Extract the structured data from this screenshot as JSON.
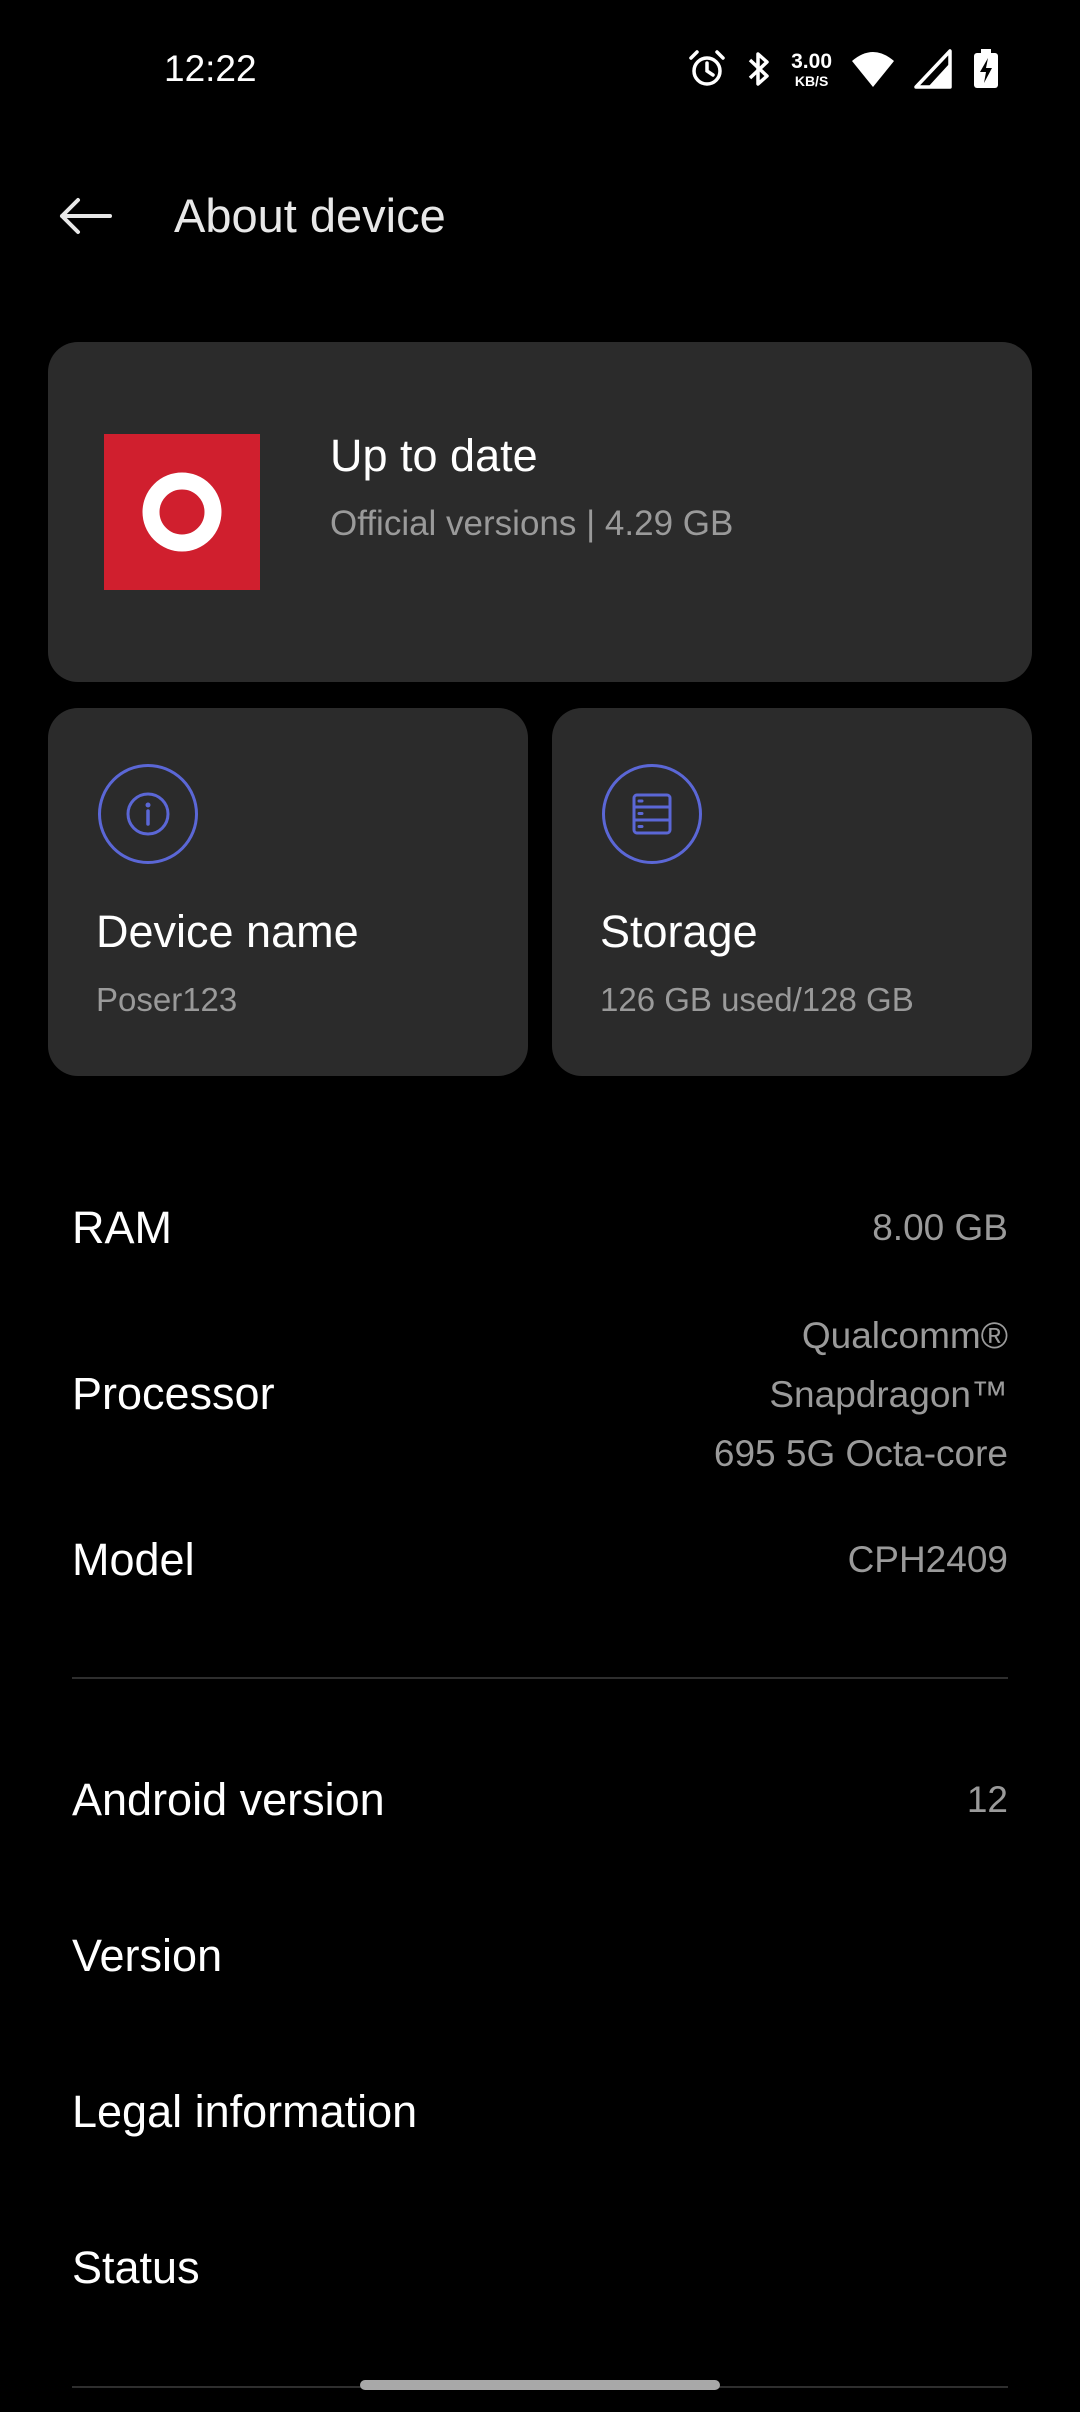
{
  "status_bar": {
    "time": "12:22",
    "net_speed_value": "3.00",
    "net_speed_unit": "KB/S",
    "icons": [
      "alarm-icon",
      "bluetooth-icon",
      "wifi-icon",
      "signal-icon",
      "battery-charging-icon"
    ]
  },
  "header": {
    "title": "About device"
  },
  "update_card": {
    "title": "Up to date",
    "subtitle": "Official versions | 4.29 GB"
  },
  "device_card": {
    "title": "Device name",
    "value": "Poser123"
  },
  "storage_card": {
    "title": "Storage",
    "value": "126 GB used/128 GB"
  },
  "specs": {
    "ram": {
      "label": "RAM",
      "value": "8.00 GB"
    },
    "processor": {
      "label": "Processor",
      "value_lines": [
        "Qualcomm®",
        "Snapdragon™",
        "695 5G Octa-core"
      ]
    },
    "model": {
      "label": "Model",
      "value": "CPH2409"
    }
  },
  "menu": {
    "android_version": {
      "label": "Android version",
      "value": "12"
    },
    "version": {
      "label": "Version"
    },
    "legal": {
      "label": "Legal information"
    },
    "status": {
      "label": "Status"
    }
  },
  "colors": {
    "background": "#000000",
    "card": "#2b2b2b",
    "accent": "#5b67d6",
    "logo_red": "#d01f2e",
    "secondary_text": "#9a9a9a"
  }
}
